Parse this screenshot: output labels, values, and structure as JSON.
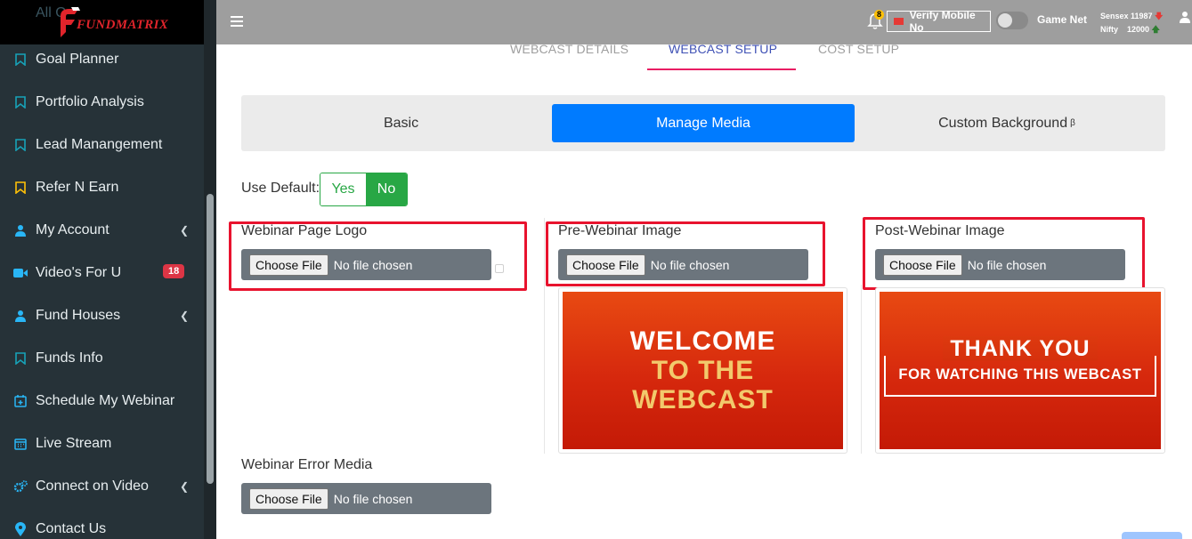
{
  "sidebar": {
    "logo_behind": "All Q",
    "logo_text": "FUNDMATRIX",
    "items": [
      {
        "label": "Goal Planner",
        "icon": "bookmark-icon"
      },
      {
        "label": "Portfolio Analysis",
        "icon": "bookmark-icon"
      },
      {
        "label": "Lead Manangement",
        "icon": "bookmark-icon"
      },
      {
        "label": "Refer N Earn",
        "icon": "bookmark-icon"
      },
      {
        "label": "My Account",
        "icon": "user-icon"
      },
      {
        "label": "Video's For U",
        "icon": "video-icon",
        "badge": "18"
      },
      {
        "label": "Fund Houses",
        "icon": "user-icon"
      },
      {
        "label": "Funds Info",
        "icon": "bookmark-icon"
      },
      {
        "label": "Schedule My Webinar",
        "icon": "calendar-plus-icon"
      },
      {
        "label": "Live Stream",
        "icon": "calendar-icon"
      },
      {
        "label": "Connect on Video",
        "icon": "cogs-icon"
      },
      {
        "label": "Contact Us",
        "icon": "map-pin-icon"
      }
    ]
  },
  "topbar": {
    "bell_count": "8",
    "verify_label": "Verify Mobile No",
    "game_label": "Game Net",
    "sensex": "Sensex 11987",
    "nifty": "Nifty",
    "nifty_value": "12000"
  },
  "main_tabs": [
    "WEBCAST DETAILS",
    "WEBCAST SETUP",
    "COST SETUP"
  ],
  "sub_tabs": {
    "basic": "Basic",
    "manage": "Manage Media",
    "custom": "Custom Background",
    "custom_sup": "β"
  },
  "use_default": {
    "label": "Use Default:",
    "yes": "Yes",
    "no": "No"
  },
  "uploads": {
    "choose_label": "Choose File",
    "no_file": "No file chosen",
    "logo_label": "Webinar Page Logo",
    "pre_label": "Pre-Webinar Image",
    "post_label": "Post-Webinar Image",
    "error_label": "Webinar Error Media"
  },
  "pre_image": {
    "line1": "WELCOME",
    "line2": "TO THE",
    "line3": "WEBCAST"
  },
  "post_image": {
    "title": "THANK YOU",
    "sub": "FOR WATCHING THIS WEBCAST"
  },
  "colors": {
    "sidebar_bg": "#263238",
    "accent_blue": "#007bff",
    "green": "#28a745",
    "highlight_red": "#e8132e",
    "tab_active": "#3f51b5",
    "tab_underline": "#e91e63"
  }
}
